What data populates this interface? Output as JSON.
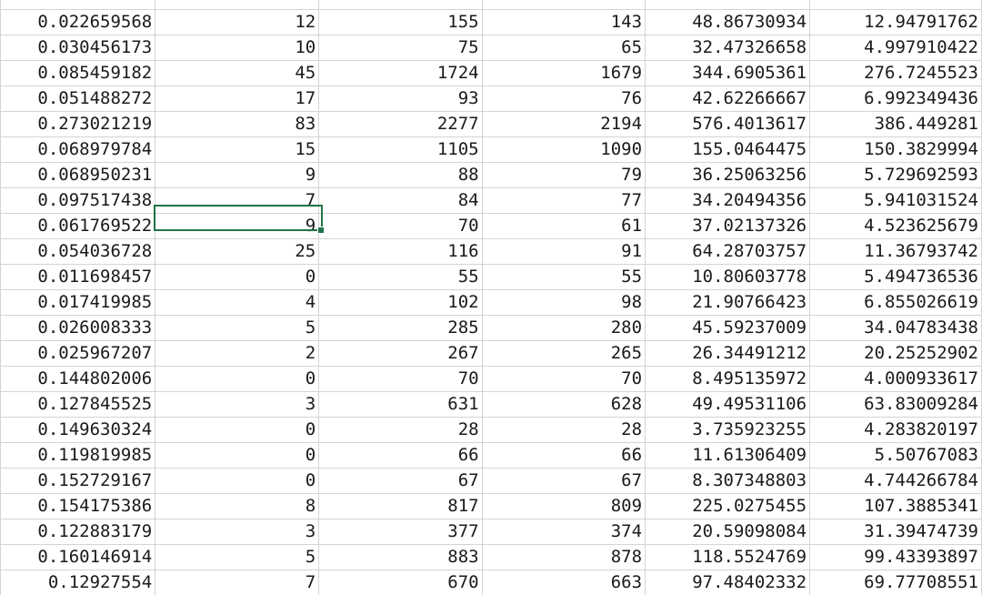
{
  "sheet": {
    "accent_color": "#217346",
    "gridline_color": "#d4d4d4",
    "selected_cell": {
      "row": 9,
      "col": 1,
      "value": "9"
    },
    "rows": [
      [
        "",
        "",
        "",
        "",
        "",
        ""
      ],
      [
        "0.022659568",
        "12",
        "155",
        "143",
        "48.86730934",
        "12.94791762"
      ],
      [
        "0.030456173",
        "10",
        "75",
        "65",
        "32.47326658",
        "4.997910422"
      ],
      [
        "0.085459182",
        "45",
        "1724",
        "1679",
        "344.6905361",
        "276.7245523"
      ],
      [
        "0.051488272",
        "17",
        "93",
        "76",
        "42.62266667",
        "6.992349436"
      ],
      [
        "0.273021219",
        "83",
        "2277",
        "2194",
        "576.4013617",
        "386.449281"
      ],
      [
        "0.068979784",
        "15",
        "1105",
        "1090",
        "155.0464475",
        "150.3829994"
      ],
      [
        "0.068950231",
        "9",
        "88",
        "79",
        "36.25063256",
        "5.729692593"
      ],
      [
        "0.097517438",
        "7",
        "84",
        "77",
        "34.20494356",
        "5.941031524"
      ],
      [
        "0.061769522",
        "9",
        "70",
        "61",
        "37.02137326",
        "4.523625679"
      ],
      [
        "0.054036728",
        "25",
        "116",
        "91",
        "64.28703757",
        "11.36793742"
      ],
      [
        "0.011698457",
        "0",
        "55",
        "55",
        "10.80603778",
        "5.494736536"
      ],
      [
        "0.017419985",
        "4",
        "102",
        "98",
        "21.90766423",
        "6.855026619"
      ],
      [
        "0.026008333",
        "5",
        "285",
        "280",
        "45.59237009",
        "34.04783438"
      ],
      [
        "0.025967207",
        "2",
        "267",
        "265",
        "26.34491212",
        "20.25252902"
      ],
      [
        "0.144802006",
        "0",
        "70",
        "70",
        "8.495135972",
        "4.000933617"
      ],
      [
        "0.127845525",
        "3",
        "631",
        "628",
        "49.49531106",
        "63.83009284"
      ],
      [
        "0.149630324",
        "0",
        "28",
        "28",
        "3.735923255",
        "4.283820197"
      ],
      [
        "0.119819985",
        "0",
        "66",
        "66",
        "11.61306409",
        "5.50767083"
      ],
      [
        "0.152729167",
        "0",
        "67",
        "67",
        "8.307348803",
        "4.744266784"
      ],
      [
        "0.154175386",
        "8",
        "817",
        "809",
        "225.0275455",
        "107.3885341"
      ],
      [
        "0.122883179",
        "3",
        "377",
        "374",
        "20.59098084",
        "31.39474739"
      ],
      [
        "0.160146914",
        "5",
        "883",
        "878",
        "118.5524769",
        "99.43393897"
      ],
      [
        "0.12927554",
        "7",
        "670",
        "663",
        "97.48402332",
        "69.77708551"
      ],
      [
        "",
        "",
        "",
        "",
        "",
        ""
      ]
    ]
  }
}
